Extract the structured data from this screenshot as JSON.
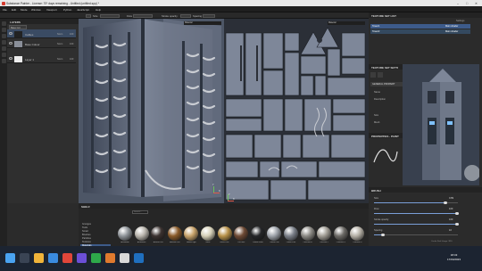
{
  "window": {
    "title": "Substance Painter - License: 70* days remaining - Untitled (untitled.spp) *",
    "min": "–",
    "max": "□",
    "close": "✕"
  },
  "menu": [
    "File",
    "Edit",
    "Mode",
    "Window",
    "Viewport",
    "Python",
    "JavaScript",
    "Help"
  ],
  "toolbar": {
    "size_label": "Size",
    "flow_label": "Flow",
    "stroke_opacity_label": "Stroke opacity",
    "spacing_label": "Spacing"
  },
  "layers": {
    "title": "LAYERS",
    "blend_mode": "Base Col",
    "items": [
      {
        "name": "Cables",
        "blend": "Norm",
        "opacity": "100"
      },
      {
        "name": "Base Colour",
        "blend": "Norm",
        "opacity": "100"
      },
      {
        "name": "Layer 1",
        "blend": "Norm",
        "opacity": "100"
      }
    ]
  },
  "viewport3d": {
    "mode": "Material",
    "axis_x": "X",
    "axis_y": "Y"
  },
  "viewport2d": {
    "mode": "Material",
    "axis_x": "X",
    "axis_y": "Y"
  },
  "shelf": {
    "title": "SHELF",
    "search_placeholder": "Search...",
    "categories": [
      "Grunges",
      "Tools",
      "Smart",
      "Brushes",
      "Particles",
      "Textures",
      "Materials"
    ],
    "active_category": "Materials",
    "materials": [
      {
        "name": "Aluminium",
        "color": "#8f9499"
      },
      {
        "name": "Aluminium",
        "color": "#b9b5ad"
      },
      {
        "name": "Artificial Lea",
        "color": "#3b3230"
      },
      {
        "name": "Autumn Leaf",
        "color": "#8a5b2a"
      },
      {
        "name": "Baked Light",
        "color": "#c7a26a"
      },
      {
        "name": "Bone",
        "color": "#d6d0b8"
      },
      {
        "name": "Brass Pure",
        "color": "#b8924a"
      },
      {
        "name": "Calf Skin",
        "color": "#6e4a34"
      },
      {
        "name": "Carbon Fiber",
        "color": "#252628"
      },
      {
        "name": "Cobalt Pure",
        "color": "#9ea3aa"
      },
      {
        "name": "Cobalt Pure",
        "color": "#7b8089"
      },
      {
        "name": "Concrete B",
        "color": "#8c8a85"
      },
      {
        "name": "Concrete C",
        "color": "#a09c94"
      },
      {
        "name": "Concrete S",
        "color": "#6c6a66"
      },
      {
        "name": "Concrete D",
        "color": "#b5b0a6"
      }
    ]
  },
  "texture_set_list": {
    "title": "TEXTURE SET LIST",
    "settings": "Settings",
    "items": [
      {
        "name": "Tower1",
        "shader": "Main shader"
      },
      {
        "name": "Tower2",
        "shader": "Main shader"
      }
    ]
  },
  "texture_set_settings": {
    "title": "TEXTURE SET SETTI",
    "general_header": "GENERAL PROPERT",
    "labels": [
      "Name",
      "Description",
      "Size",
      "Mesh"
    ]
  },
  "properties": {
    "title": "PROPERTIES - PAINT",
    "brush_header": "BRUSH",
    "size_label": "Size",
    "size_value": "0.89",
    "flow_label": "Flow",
    "flow_value": "100",
    "stroke_label": "Stroke opacity",
    "stroke_value": "100",
    "spacing_label": "Spacing",
    "spacing_value": "10"
  },
  "status": "Cache Disk Usage: 39%",
  "taskbar": {
    "time": "18:43",
    "date": "17/04/2023"
  },
  "colors": {
    "accent": "#3d5b8a",
    "selection": "#7a9fd8",
    "viewport": "#4a5363"
  }
}
